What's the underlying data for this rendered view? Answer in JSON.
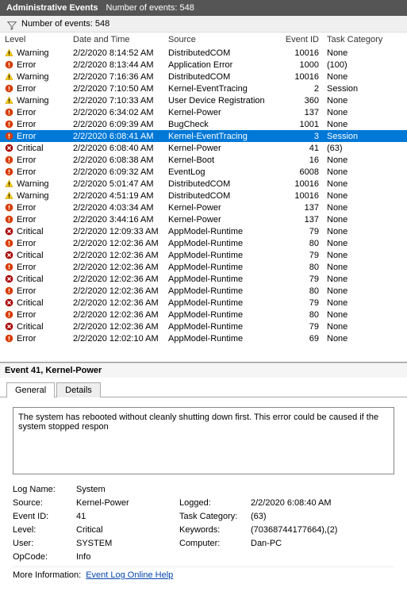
{
  "titlebar": {
    "title": "Administrative Events",
    "subtitle": "Number of events: 548"
  },
  "summary": "Number of events: 548",
  "columns": {
    "level": "Level",
    "date": "Date and Time",
    "source": "Source",
    "eventid": "Event ID",
    "task": "Task Category"
  },
  "selected_index": 7,
  "events": [
    {
      "level": "Warning",
      "icon": "warning",
      "date": "2/2/2020 8:14:52 AM",
      "source": "DistributedCOM",
      "id": "10016",
      "task": "None"
    },
    {
      "level": "Error",
      "icon": "error",
      "date": "2/2/2020 8:13:44 AM",
      "source": "Application Error",
      "id": "1000",
      "task": "(100)"
    },
    {
      "level": "Warning",
      "icon": "warning",
      "date": "2/2/2020 7:16:36 AM",
      "source": "DistributedCOM",
      "id": "10016",
      "task": "None"
    },
    {
      "level": "Error",
      "icon": "error",
      "date": "2/2/2020 7:10:50 AM",
      "source": "Kernel-EventTracing",
      "id": "2",
      "task": "Session"
    },
    {
      "level": "Warning",
      "icon": "warning",
      "date": "2/2/2020 7:10:33 AM",
      "source": "User Device Registration",
      "id": "360",
      "task": "None"
    },
    {
      "level": "Error",
      "icon": "error",
      "date": "2/2/2020 6:34:02 AM",
      "source": "Kernel-Power",
      "id": "137",
      "task": "None"
    },
    {
      "level": "Error",
      "icon": "error",
      "date": "2/2/2020 6:09:39 AM",
      "source": "BugCheck",
      "id": "1001",
      "task": "None"
    },
    {
      "level": "Error",
      "icon": "error",
      "date": "2/2/2020 6:08:41 AM",
      "source": "Kernel-EventTracing",
      "id": "3",
      "task": "Session"
    },
    {
      "level": "Critical",
      "icon": "critical",
      "date": "2/2/2020 6:08:40 AM",
      "source": "Kernel-Power",
      "id": "41",
      "task": "(63)"
    },
    {
      "level": "Error",
      "icon": "error",
      "date": "2/2/2020 6:08:38 AM",
      "source": "Kernel-Boot",
      "id": "16",
      "task": "None"
    },
    {
      "level": "Error",
      "icon": "error",
      "date": "2/2/2020 6:09:32 AM",
      "source": "EventLog",
      "id": "6008",
      "task": "None"
    },
    {
      "level": "Warning",
      "icon": "warning",
      "date": "2/2/2020 5:01:47 AM",
      "source": "DistributedCOM",
      "id": "10016",
      "task": "None"
    },
    {
      "level": "Warning",
      "icon": "warning",
      "date": "2/2/2020 4:51:19 AM",
      "source": "DistributedCOM",
      "id": "10016",
      "task": "None"
    },
    {
      "level": "Error",
      "icon": "error",
      "date": "2/2/2020 4:03:34 AM",
      "source": "Kernel-Power",
      "id": "137",
      "task": "None"
    },
    {
      "level": "Error",
      "icon": "error",
      "date": "2/2/2020 3:44:16 AM",
      "source": "Kernel-Power",
      "id": "137",
      "task": "None"
    },
    {
      "level": "Critical",
      "icon": "critical",
      "date": "2/2/2020 12:09:33 AM",
      "source": "AppModel-Runtime",
      "id": "79",
      "task": "None"
    },
    {
      "level": "Error",
      "icon": "error",
      "date": "2/2/2020 12:02:36 AM",
      "source": "AppModel-Runtime",
      "id": "80",
      "task": "None"
    },
    {
      "level": "Critical",
      "icon": "critical",
      "date": "2/2/2020 12:02:36 AM",
      "source": "AppModel-Runtime",
      "id": "79",
      "task": "None"
    },
    {
      "level": "Error",
      "icon": "error",
      "date": "2/2/2020 12:02:36 AM",
      "source": "AppModel-Runtime",
      "id": "80",
      "task": "None"
    },
    {
      "level": "Critical",
      "icon": "critical",
      "date": "2/2/2020 12:02:36 AM",
      "source": "AppModel-Runtime",
      "id": "79",
      "task": "None"
    },
    {
      "level": "Error",
      "icon": "error",
      "date": "2/2/2020 12:02:36 AM",
      "source": "AppModel-Runtime",
      "id": "80",
      "task": "None"
    },
    {
      "level": "Critical",
      "icon": "critical",
      "date": "2/2/2020 12:02:36 AM",
      "source": "AppModel-Runtime",
      "id": "79",
      "task": "None"
    },
    {
      "level": "Error",
      "icon": "error",
      "date": "2/2/2020 12:02:36 AM",
      "source": "AppModel-Runtime",
      "id": "80",
      "task": "None"
    },
    {
      "level": "Critical",
      "icon": "critical",
      "date": "2/2/2020 12:02:36 AM",
      "source": "AppModel-Runtime",
      "id": "79",
      "task": "None"
    },
    {
      "level": "Error",
      "icon": "error",
      "date": "2/2/2020 12:02:10 AM",
      "source": "AppModel-Runtime",
      "id": "69",
      "task": "None"
    }
  ],
  "detail": {
    "title": "Event 41, Kernel-Power",
    "tabs": {
      "general": "General",
      "details": "Details"
    },
    "description": "The system has rebooted without cleanly shutting down first. This error could be caused if the system stopped respon",
    "labels": {
      "logname": "Log Name:",
      "source": "Source:",
      "eventid": "Event ID:",
      "level": "Level:",
      "user": "User:",
      "opcode": "OpCode:",
      "logged": "Logged:",
      "task": "Task Category:",
      "keywords": "Keywords:",
      "computer": "Computer:",
      "moreinfo": "More Information:",
      "helplink": "Event Log Online Help"
    },
    "values": {
      "logname": "System",
      "source": "Kernel-Power",
      "eventid": "41",
      "level": "Critical",
      "user": "SYSTEM",
      "opcode": "Info",
      "logged": "2/2/2020 6:08:40 AM",
      "task": "(63)",
      "keywords": "(70368744177664),(2)",
      "computer": "Dan-PC"
    }
  }
}
